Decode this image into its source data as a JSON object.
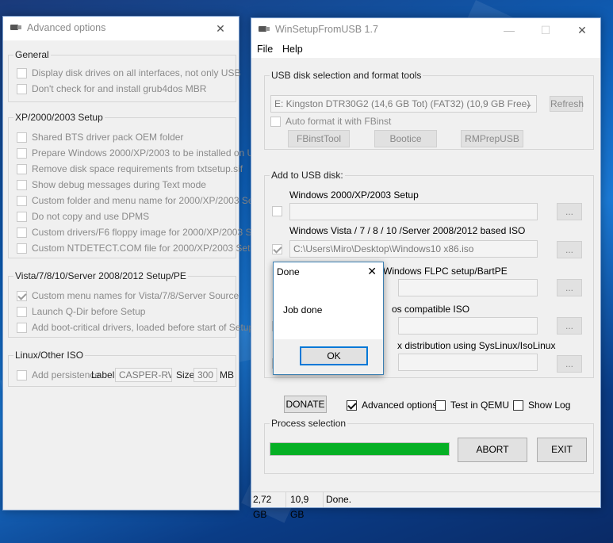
{
  "adv": {
    "title": "Advanced options",
    "general": {
      "label": "General",
      "options": [
        {
          "text": "Display disk drives on all interfaces, not only USB",
          "checked": false
        },
        {
          "text": "Don't check for and install grub4dos MBR",
          "checked": false
        }
      ]
    },
    "xp": {
      "label": "XP/2000/2003 Setup",
      "options": [
        {
          "text": "Shared BTS driver pack OEM folder",
          "checked": false
        },
        {
          "text": "Prepare Windows 2000/XP/2003 to be installed on USB",
          "checked": false
        },
        {
          "text": "Remove disk space requirements from txtsetup.sif",
          "checked": false
        },
        {
          "text": "Show debug messages during Text mode",
          "checked": false
        },
        {
          "text": "Custom folder and menu name for 2000/XP/2003 Setup",
          "checked": false
        },
        {
          "text": "Do not copy and use DPMS",
          "checked": false
        },
        {
          "text": "Custom drivers/F6 floppy image for 2000/XP/2003 Setup",
          "checked": false
        },
        {
          "text": "Custom NTDETECT.COM file for 2000/XP/2003 Setup",
          "checked": false
        }
      ]
    },
    "vista": {
      "label": "Vista/7/8/10/Server 2008/2012 Setup/PE",
      "options": [
        {
          "text": "Custom menu names for Vista/7/8/Server Source",
          "checked": true
        },
        {
          "text": "Launch Q-Dir before Setup",
          "checked": false
        },
        {
          "text": "Add boot-critical drivers, loaded before start of Setup",
          "checked": false
        }
      ]
    },
    "linux": {
      "label": "Linux/Other ISO",
      "persistence": "Add persistence",
      "label_text": "Label",
      "label_value": "CASPER-RW",
      "size_text": "Size",
      "size_value": "300",
      "unit": "MB"
    }
  },
  "main": {
    "title": "WinSetupFromUSB 1.7",
    "menu": {
      "file": "File",
      "help": "Help"
    },
    "usb_group": "USB disk selection and format tools",
    "disk": "E: Kingston DTR30G2 (14,6 GB Tot) (FAT32) (10,9 GB Free)",
    "refresh": "Refresh",
    "autoformat": "Auto format it with FBinst",
    "tools": {
      "fbinst": "FBinstTool",
      "bootice": "Bootice",
      "rmprep": "RMPrepUSB"
    },
    "add_group": "Add to USB disk:",
    "sources": [
      {
        "label": "Windows 2000/XP/2003 Setup",
        "value": "",
        "checked": false
      },
      {
        "label": "Windows Vista / 7 / 8 / 10 /Server 2008/2012 based ISO",
        "value": "C:\\Users\\Miro\\Desktop\\Windows10 x86.iso",
        "checked": true
      },
      {
        "label": "Windows FLPC setup/BartPE",
        "value": "",
        "checked": false
      },
      {
        "label": "os compatible ISO",
        "value": "",
        "checked": false
      },
      {
        "label": "x distribution using SysLinux/IsoLinux",
        "value": "",
        "checked": false
      }
    ],
    "browse": "...",
    "donate": "DONATE",
    "advanced_options": "Advanced options",
    "test_qemu": "Test in QEMU",
    "show_log": "Show Log",
    "process_group": "Process selection",
    "progress": 1.0,
    "abort": "ABORT",
    "exit": "EXIT",
    "status": [
      "2,72 GB",
      "10,9 GB",
      "Done."
    ]
  },
  "dialog": {
    "title": "Done",
    "message": "Job done",
    "ok": "OK"
  },
  "colors": {
    "progress": "#06b025",
    "accent": "#0078d7"
  }
}
